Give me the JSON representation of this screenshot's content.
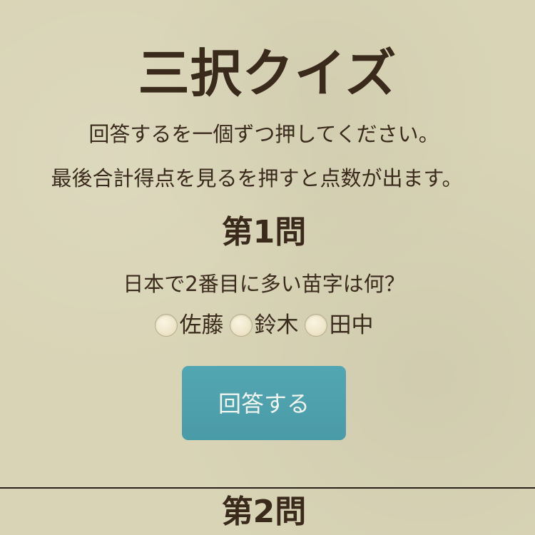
{
  "header": {
    "title": "三択クイズ"
  },
  "instructions": {
    "line1": "回答するを一個ずつ押してください。",
    "line2": "最後合計得点を見るを押すと点数が出ます。"
  },
  "questions": [
    {
      "heading": "第1問",
      "text": "日本で2番目に多い苗字は何？",
      "options": [
        {
          "label": "佐藤",
          "selected": false
        },
        {
          "label": "鈴木",
          "selected": false
        },
        {
          "label": "田中",
          "selected": false
        }
      ],
      "answer_label": "回答する"
    },
    {
      "heading": "第2問"
    }
  ],
  "colors": {
    "background": "#d9d4b6",
    "text": "#3a2a1c",
    "button": "#4ea1ad",
    "button_text": "#f2f4ef"
  }
}
